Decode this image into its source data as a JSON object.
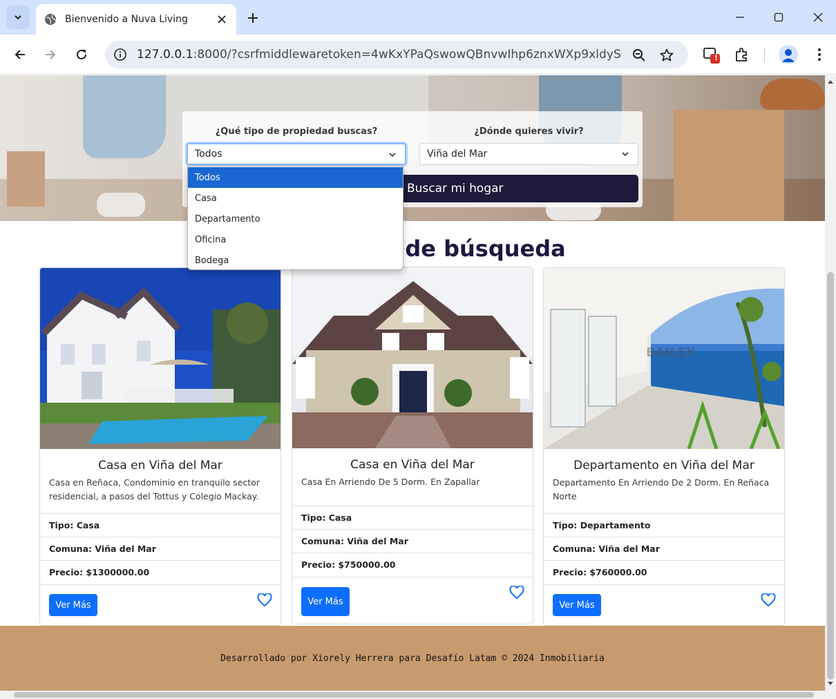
{
  "browser": {
    "tab_title": "Bienvenido a Nuva Living",
    "url_host": "127.0.0.1",
    "url_rest": ":8000/?csrfmiddlewaretoken=4wKxYPaQswowQBnvwIhp6znxWXp9xldySGfjHVUy...",
    "extension_badge": "!"
  },
  "search": {
    "type_label": "¿Qué tipo de propiedad buscas?",
    "type_value": "Todos",
    "location_label": "¿Dónde quieres vivir?",
    "location_value": "Viña del Mar",
    "submit_label": "Buscar mi hogar",
    "type_options": [
      "Todos",
      "Casa",
      "Departamento",
      "Oficina",
      "Bodega"
    ],
    "type_selected_index": 0
  },
  "results": {
    "title": "Resultados de búsqueda"
  },
  "cards": [
    {
      "title": "Casa en Viña del Mar",
      "description": "Casa en Reñaca, Condominio en tranquilo sector residencial, a pasos del Tottus y Colegio Mackay.",
      "tipo": "Tipo: Casa",
      "comuna": "Comuna: Viña del Mar",
      "precio": "Precio: $1300000.00",
      "button": "Ver Más"
    },
    {
      "title": "Casa en Viña del Mar",
      "description": "Casa En Arriendo De 5 Dorm. En Zapallar",
      "tipo": "Tipo: Casa",
      "comuna": "Comuna: Viña del Mar",
      "precio": "Precio: $750000.00",
      "button": "Ver Más"
    },
    {
      "title": "Departamento en Viña del Mar",
      "description": "Departamento En Arriendo De 2 Dorm. En Reñaca Norte",
      "tipo": "Tipo: Departamento",
      "comuna": "Comuna: Viña del Mar",
      "precio": "Precio: $760000.00",
      "button": "Ver Más",
      "watermark": "BAILEY"
    }
  ],
  "footer": {
    "text": "Desarrollado por Xiorely Herrera para Desafío Latam © 2024 Inmobiliaria"
  },
  "colors": {
    "brand_dark": "#1d1a3a",
    "primary": "#0d6efd",
    "footer_bg": "#c89b6e",
    "tabstrip": "#d3e3fd"
  }
}
